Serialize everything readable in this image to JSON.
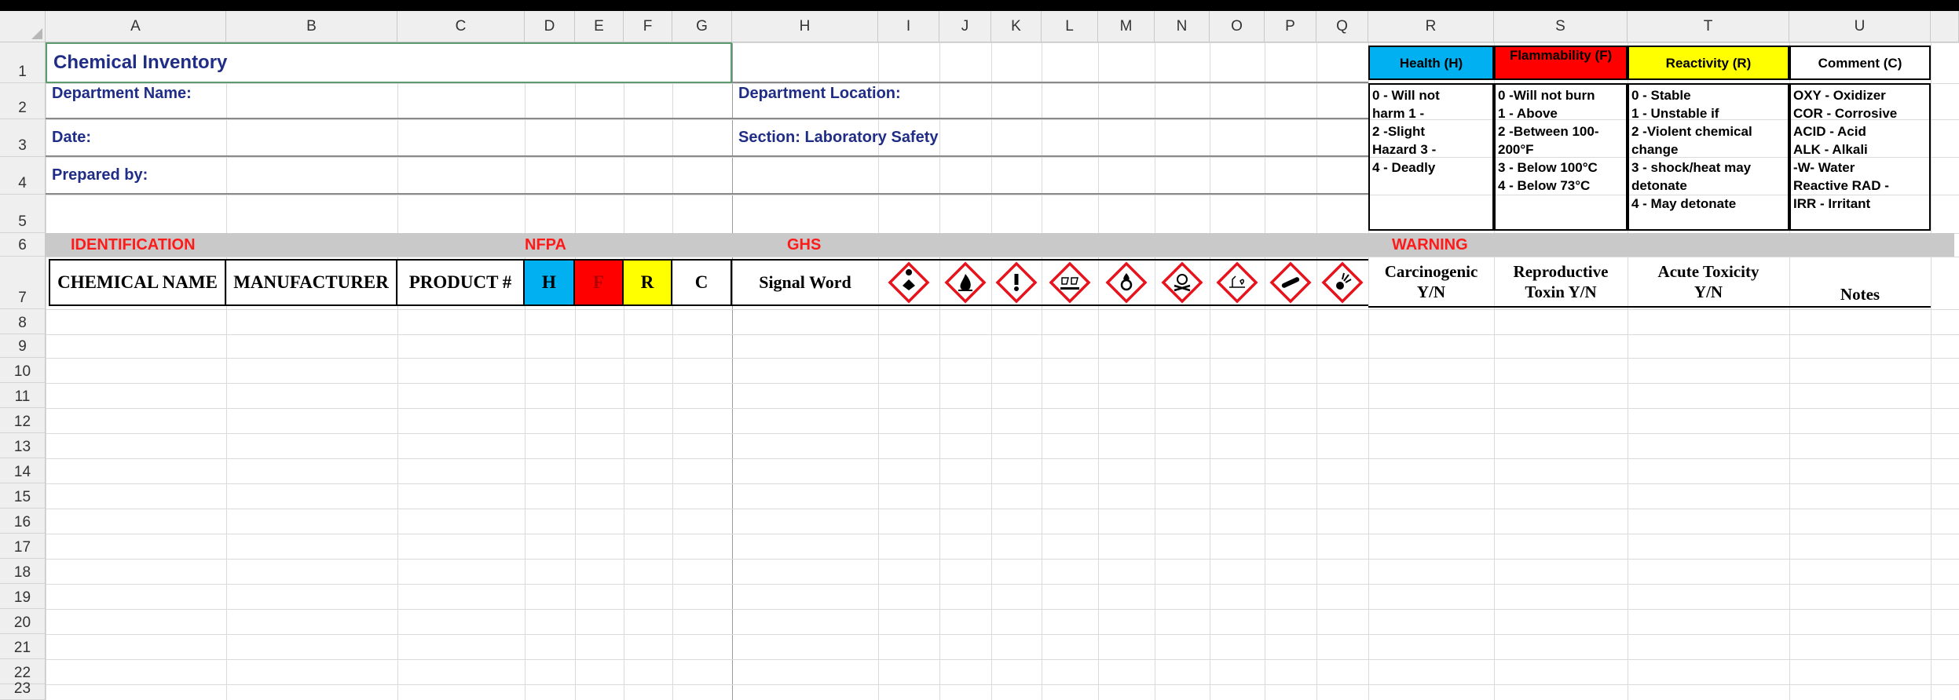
{
  "columns": [
    "A",
    "B",
    "C",
    "D",
    "E",
    "F",
    "G",
    "H",
    "I",
    "J",
    "K",
    "L",
    "M",
    "N",
    "O",
    "P",
    "Q",
    "R",
    "S",
    "T",
    "U"
  ],
  "rows": [
    "1",
    "2",
    "3",
    "4",
    "5",
    "6",
    "7",
    "8",
    "9",
    "10",
    "11",
    "12",
    "13",
    "14",
    "15",
    "16",
    "17",
    "18",
    "19",
    "20",
    "21",
    "22",
    "23"
  ],
  "header": {
    "title": "Chemical Inventory",
    "department_name": "Department Name:",
    "department_location": "Department Location:",
    "date": "Date:",
    "section": "Section: Laboratory Safety",
    "prepared_by": "Prepared by:"
  },
  "sections": {
    "identification": "IDENTIFICATION",
    "nfpa": "NFPA",
    "ghs": "GHS",
    "warning": "WARNING"
  },
  "table_headers": {
    "chemical_name": "CHEMICAL NAME",
    "manufacturer": "MANUFACTURER",
    "product": "PRODUCT #",
    "h": "H",
    "f": "F",
    "r": "R",
    "c": "C",
    "signal_word": "Signal Word",
    "carcinogenic_1": "Carcinogenic",
    "carcinogenic_2": "Y/N",
    "reproductive_1": "Reproductive",
    "reproductive_2": "Toxin Y/N",
    "acute_1": "Acute Toxicity",
    "acute_2": "Y/N",
    "notes": "Notes"
  },
  "ghs_pictograms": [
    "health-hazard-icon",
    "flame-icon",
    "exclamation-mark-icon",
    "corrosion-icon",
    "flame-over-circle-icon",
    "skull-crossbones-icon",
    "environment-icon",
    "gas-cylinder-icon",
    "exploding-bomb-icon"
  ],
  "legend": {
    "health": {
      "title": "Health (H)",
      "color": "#00b0f0",
      "lines": [
        "0 - Will not",
        "harm      1 -",
        "2 -Slight",
        "Hazard       3 -",
        "4 - Deadly"
      ]
    },
    "flammability": {
      "title": "Flammability (F)",
      "color": "#ff0000",
      "lines": [
        "0 -Will not burn",
        "1 - Above",
        "2 -Between 100-",
        "200°F",
        "3 - Below 100°C",
        "4 - Below 73°C"
      ]
    },
    "reactivity": {
      "title": "Reactivity (R)",
      "color": "#ffff00",
      "lines": [
        "0 - Stable",
        "1 - Unstable if",
        "2 -Violent chemical",
        "change",
        "3 - shock/heat may",
        "detonate",
        "4 - May detonate"
      ]
    },
    "comment": {
      "title": "Comment (C)",
      "color": "#ffffff",
      "lines": [
        "OXY - Oxidizer",
        "COR - Corrosive",
        "ACID - Acid",
        "ALK - Alkali",
        "-W- Water",
        "Reactive    RAD -",
        "IRR - Irritant"
      ]
    }
  },
  "colors": {
    "nfpa_h": "#00b0f0",
    "nfpa_f": "#ff0000",
    "nfpa_r": "#ffff00",
    "section_red": "#ff1a1a",
    "title_blue": "#1f2d86",
    "band_gray": "#c9c9c9"
  }
}
